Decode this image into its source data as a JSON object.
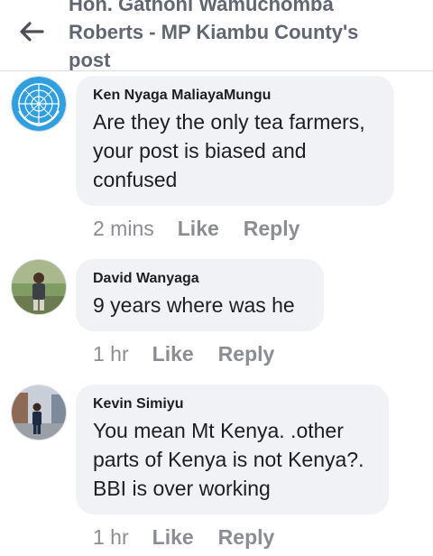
{
  "header": {
    "back_icon": "arrow-left-icon",
    "title": "Hon. Gathoni Wamuchomba Roberts - MP Kiambu County's post"
  },
  "comments": [
    {
      "author": "Ken Nyaga MaliayaMungu",
      "avatar_icon": "un-emblem-avatar",
      "text": "Are they the only tea farmers, your post is biased and confused",
      "time": "2 mins",
      "like_label": "Like",
      "reply_label": "Reply"
    },
    {
      "author": "David Wanyaga",
      "avatar_icon": "person-photo-avatar",
      "text": "9 years where was he",
      "time": "1 hr",
      "like_label": "Like",
      "reply_label": "Reply"
    },
    {
      "author": "Kevin Simiyu",
      "avatar_icon": "person-photo-avatar",
      "text": "You mean Mt Kenya. .other parts of Kenya is not Kenya?. BBI is over working",
      "time": "1 hr",
      "like_label": "Like",
      "reply_label": "Reply"
    }
  ]
}
